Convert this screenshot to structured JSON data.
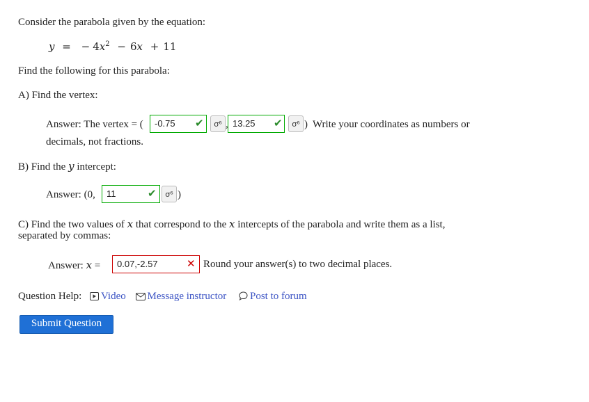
{
  "intro": "Consider the parabola given by the equation:",
  "equation": {
    "lhs": "y",
    "eq": "=",
    "minus1": "−",
    "coef2": "4",
    "var2": "x",
    "exp2": "2",
    "minus2": "−",
    "coef1": "6",
    "var1": "x",
    "plus": "+",
    "const": "11"
  },
  "find_following": "Find the following for this parabola:",
  "partA": {
    "label": "A) Find the vertex:",
    "answer_prefix": "Answer: The vertex = (",
    "input1_value": "-0.75",
    "comma": ",",
    "input2_value": "13.25",
    "close_paren": ")",
    "instruction_line1": "Write your coordinates as numbers or",
    "instruction_line2": "decimals, not fractions."
  },
  "partB": {
    "label_prefix": "B) Find the ",
    "label_var": "y",
    "label_suffix": " intercept:",
    "answer_prefix": "Answer:  (0,",
    "input_value": "11",
    "close_paren": ")"
  },
  "partC": {
    "line1_a": "C) Find the two values of ",
    "line1_var": "x",
    "line1_b": " that correspond to the ",
    "line1_var2": "x",
    "line1_c": " intercepts of the parabola and write them as a list,",
    "line2": "separated by commas:",
    "answer_prefix": "Answer: ",
    "answer_var": "x",
    "answer_eq": " =",
    "input_value": "0.07,-2.57",
    "instruction": "Round your answer(s) to two decimal places."
  },
  "help": {
    "label": "Question Help:",
    "video": "Video",
    "message": "Message instructor",
    "forum": "Post to forum"
  },
  "submit_label": "Submit Question",
  "icons": {
    "check": "✔",
    "cross": "✕",
    "preview": "σ⁶"
  },
  "colors": {
    "correct": "#2a8a2a",
    "incorrect": "#cc0000",
    "link": "#3b53c4",
    "submit": "#1f70d6"
  }
}
